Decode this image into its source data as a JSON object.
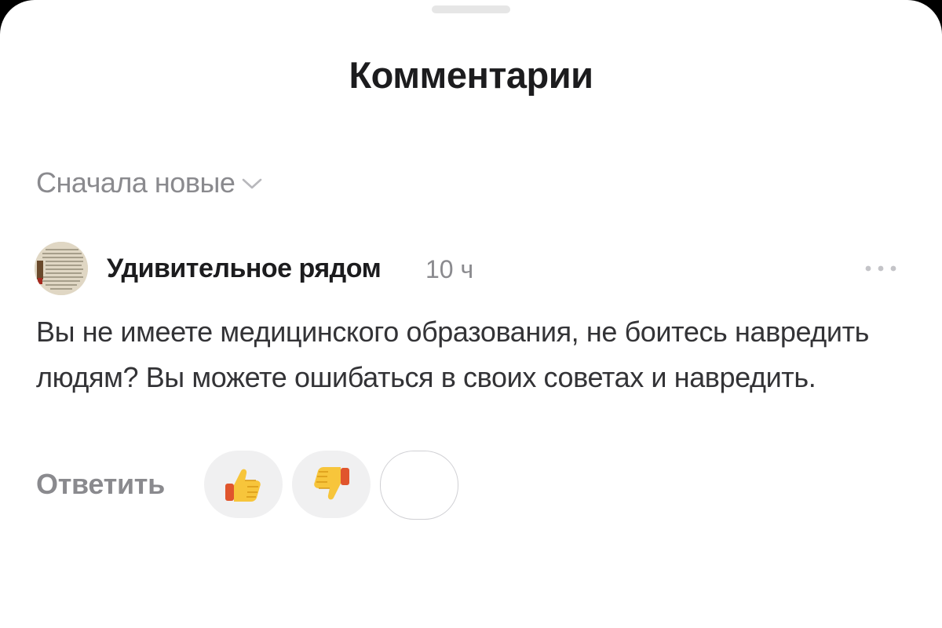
{
  "sheet": {
    "title": "Комментарии"
  },
  "sort": {
    "label": "Сначала новые",
    "icon": "chevron-down-icon"
  },
  "comment": {
    "author": "Удивительное рядом",
    "time": "10 ч",
    "text": "Вы не имеете медицинского образования, не боитесь навредить людям? Вы можете ошибаться в своих советах и навредить.",
    "reply_label": "Ответить",
    "reactions": [
      {
        "name": "thumbs-up",
        "icon": "thumbs-up-icon"
      },
      {
        "name": "thumbs-down",
        "icon": "thumbs-down-icon"
      },
      {
        "name": "empty-reaction",
        "icon": "none"
      }
    ]
  },
  "colors": {
    "background": "#ffffff",
    "muted_text": "#8a8a8e",
    "primary_text": "#1c1c1e",
    "pill": "#f0f0f1",
    "emoji_yellow": "#f7c53b",
    "emoji_red": "#d64b2a"
  }
}
